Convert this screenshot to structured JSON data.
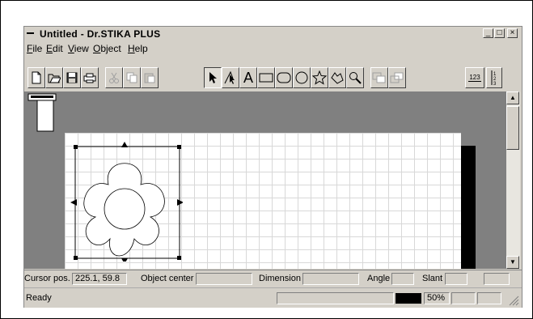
{
  "window": {
    "title": "Untitled - Dr.STIKA PLUS",
    "controls": [
      "_",
      "□",
      "×"
    ]
  },
  "menu": [
    {
      "label": "File",
      "mnemonic": "F",
      "rest": "ile"
    },
    {
      "label": "Edit",
      "mnemonic": "E",
      "rest": "dit"
    },
    {
      "label": "View",
      "mnemonic": "V",
      "rest": "iew"
    },
    {
      "label": "Object",
      "mnemonic": "O",
      "rest": "bject"
    },
    {
      "label": "Help",
      "mnemonic": "H",
      "rest": "elp"
    }
  ],
  "toolbar": {
    "text_tool_label": "A",
    "number_label": "123"
  },
  "status": {
    "cursor_label": "Cursor pos.",
    "cursor_value": "225.1, 59.8",
    "object_center_label": "Object center",
    "object_center_value": "",
    "dimension_label": "Dimension",
    "dimension_value": "",
    "angle_label": "Angle",
    "angle_value": "",
    "slant_label": "Slant",
    "slant_value": "",
    "ready_text": "Ready",
    "zoom": "50%"
  }
}
